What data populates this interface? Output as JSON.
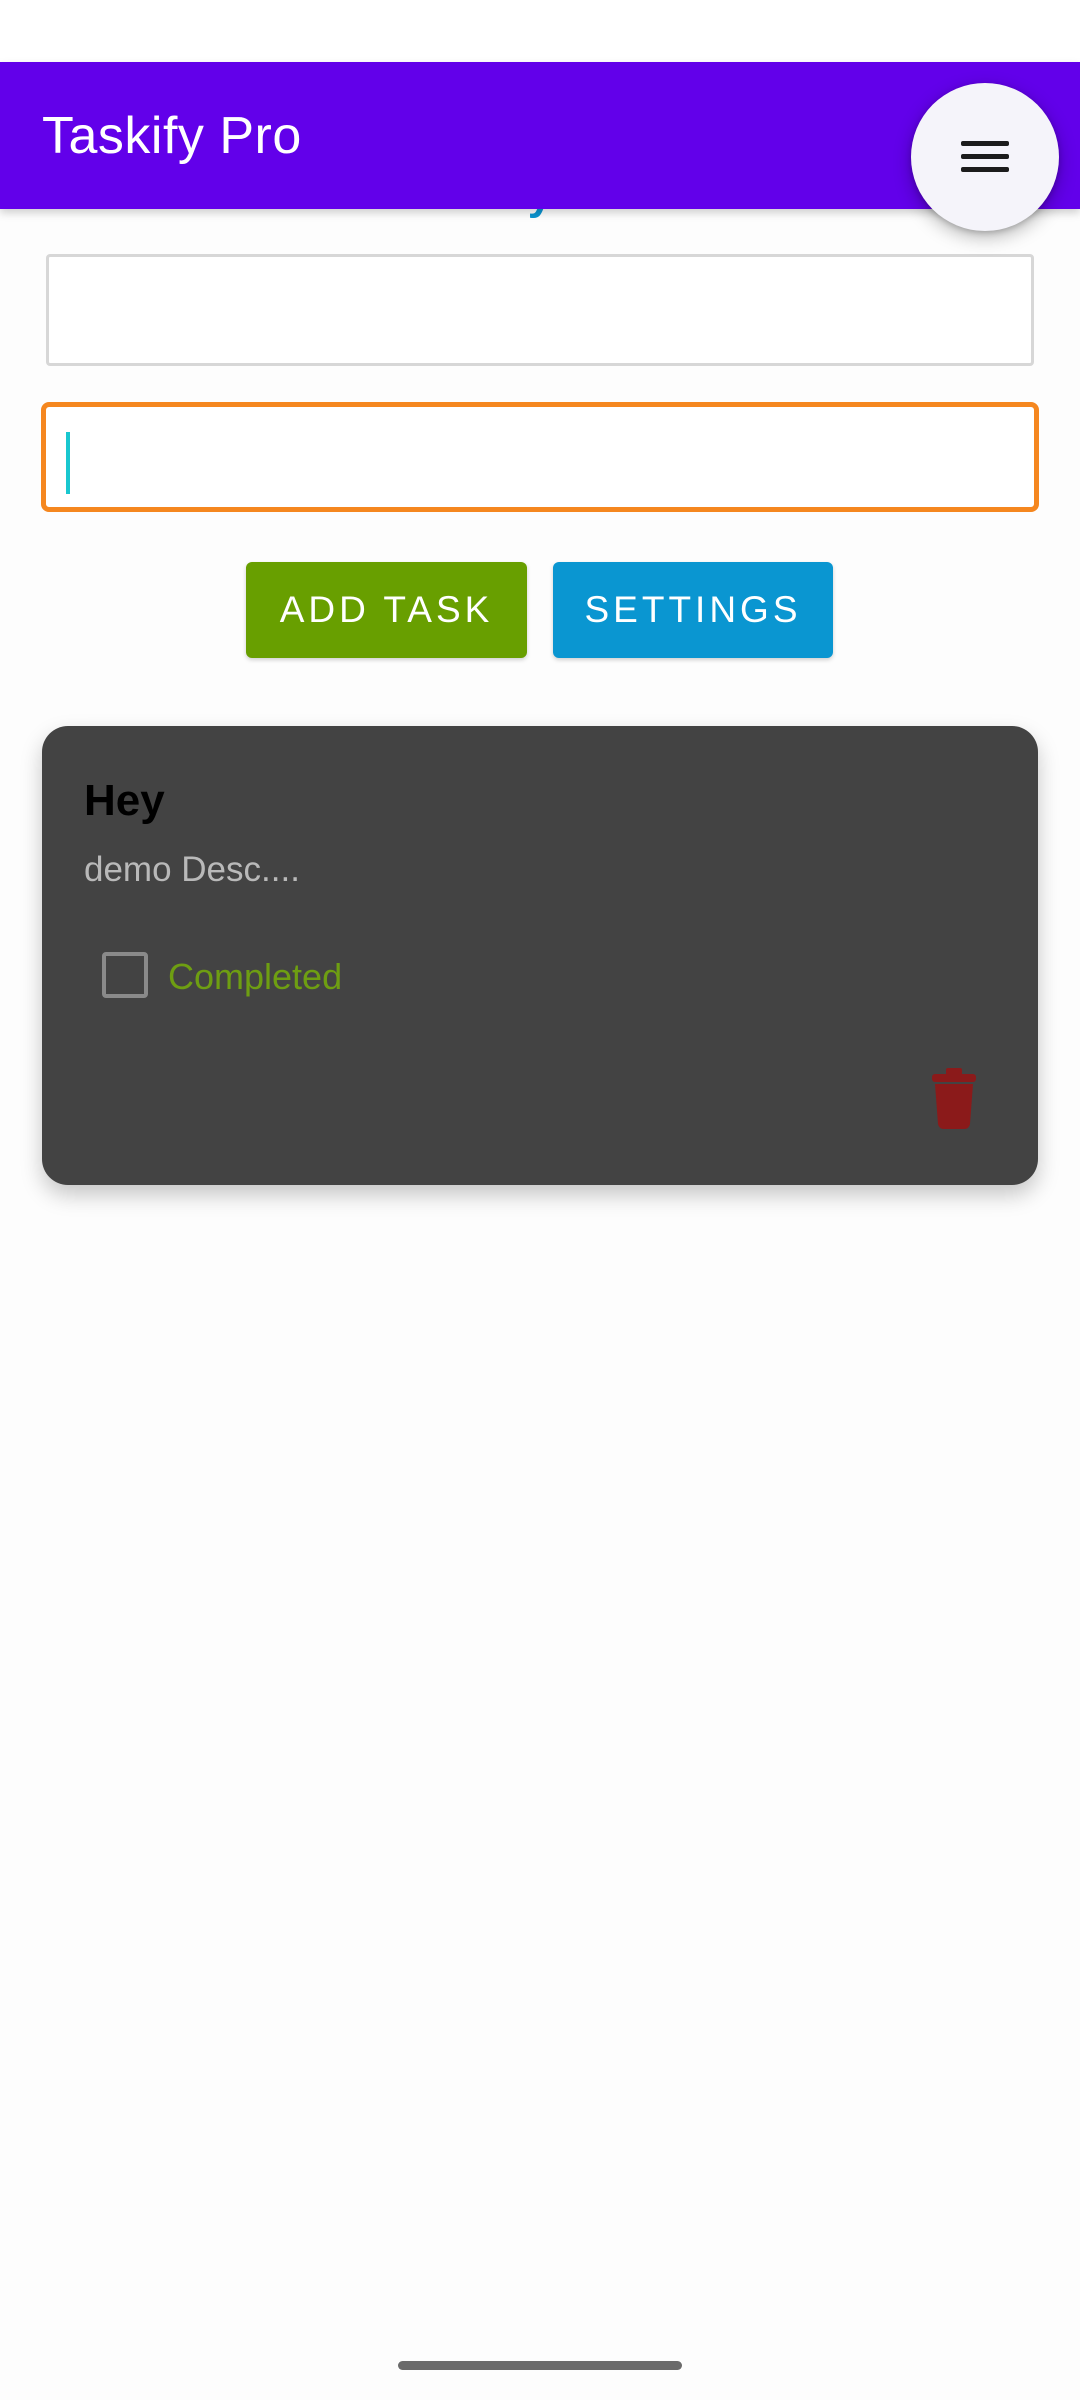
{
  "app_bar": {
    "title": "Taskify Pro",
    "background_color": "#6200ea",
    "menu_icon": "hamburger-menu-icon"
  },
  "form": {
    "heading_partial": "y",
    "title_input": {
      "value": "",
      "placeholder": ""
    },
    "description_input": {
      "value": "",
      "placeholder": ""
    },
    "add_task_label": "ADD TASK",
    "settings_label": "SETTINGS",
    "add_task_color": "#689f00",
    "settings_color": "#0a96d1",
    "focus_border_color": "#f5871f"
  },
  "tasks": [
    {
      "title": "Hey",
      "description": "demo Desc....",
      "completed": false,
      "completed_label": "Completed",
      "delete_icon": "trash-icon",
      "card_color": "#434343",
      "delete_color": "#8b1a1a"
    }
  ]
}
